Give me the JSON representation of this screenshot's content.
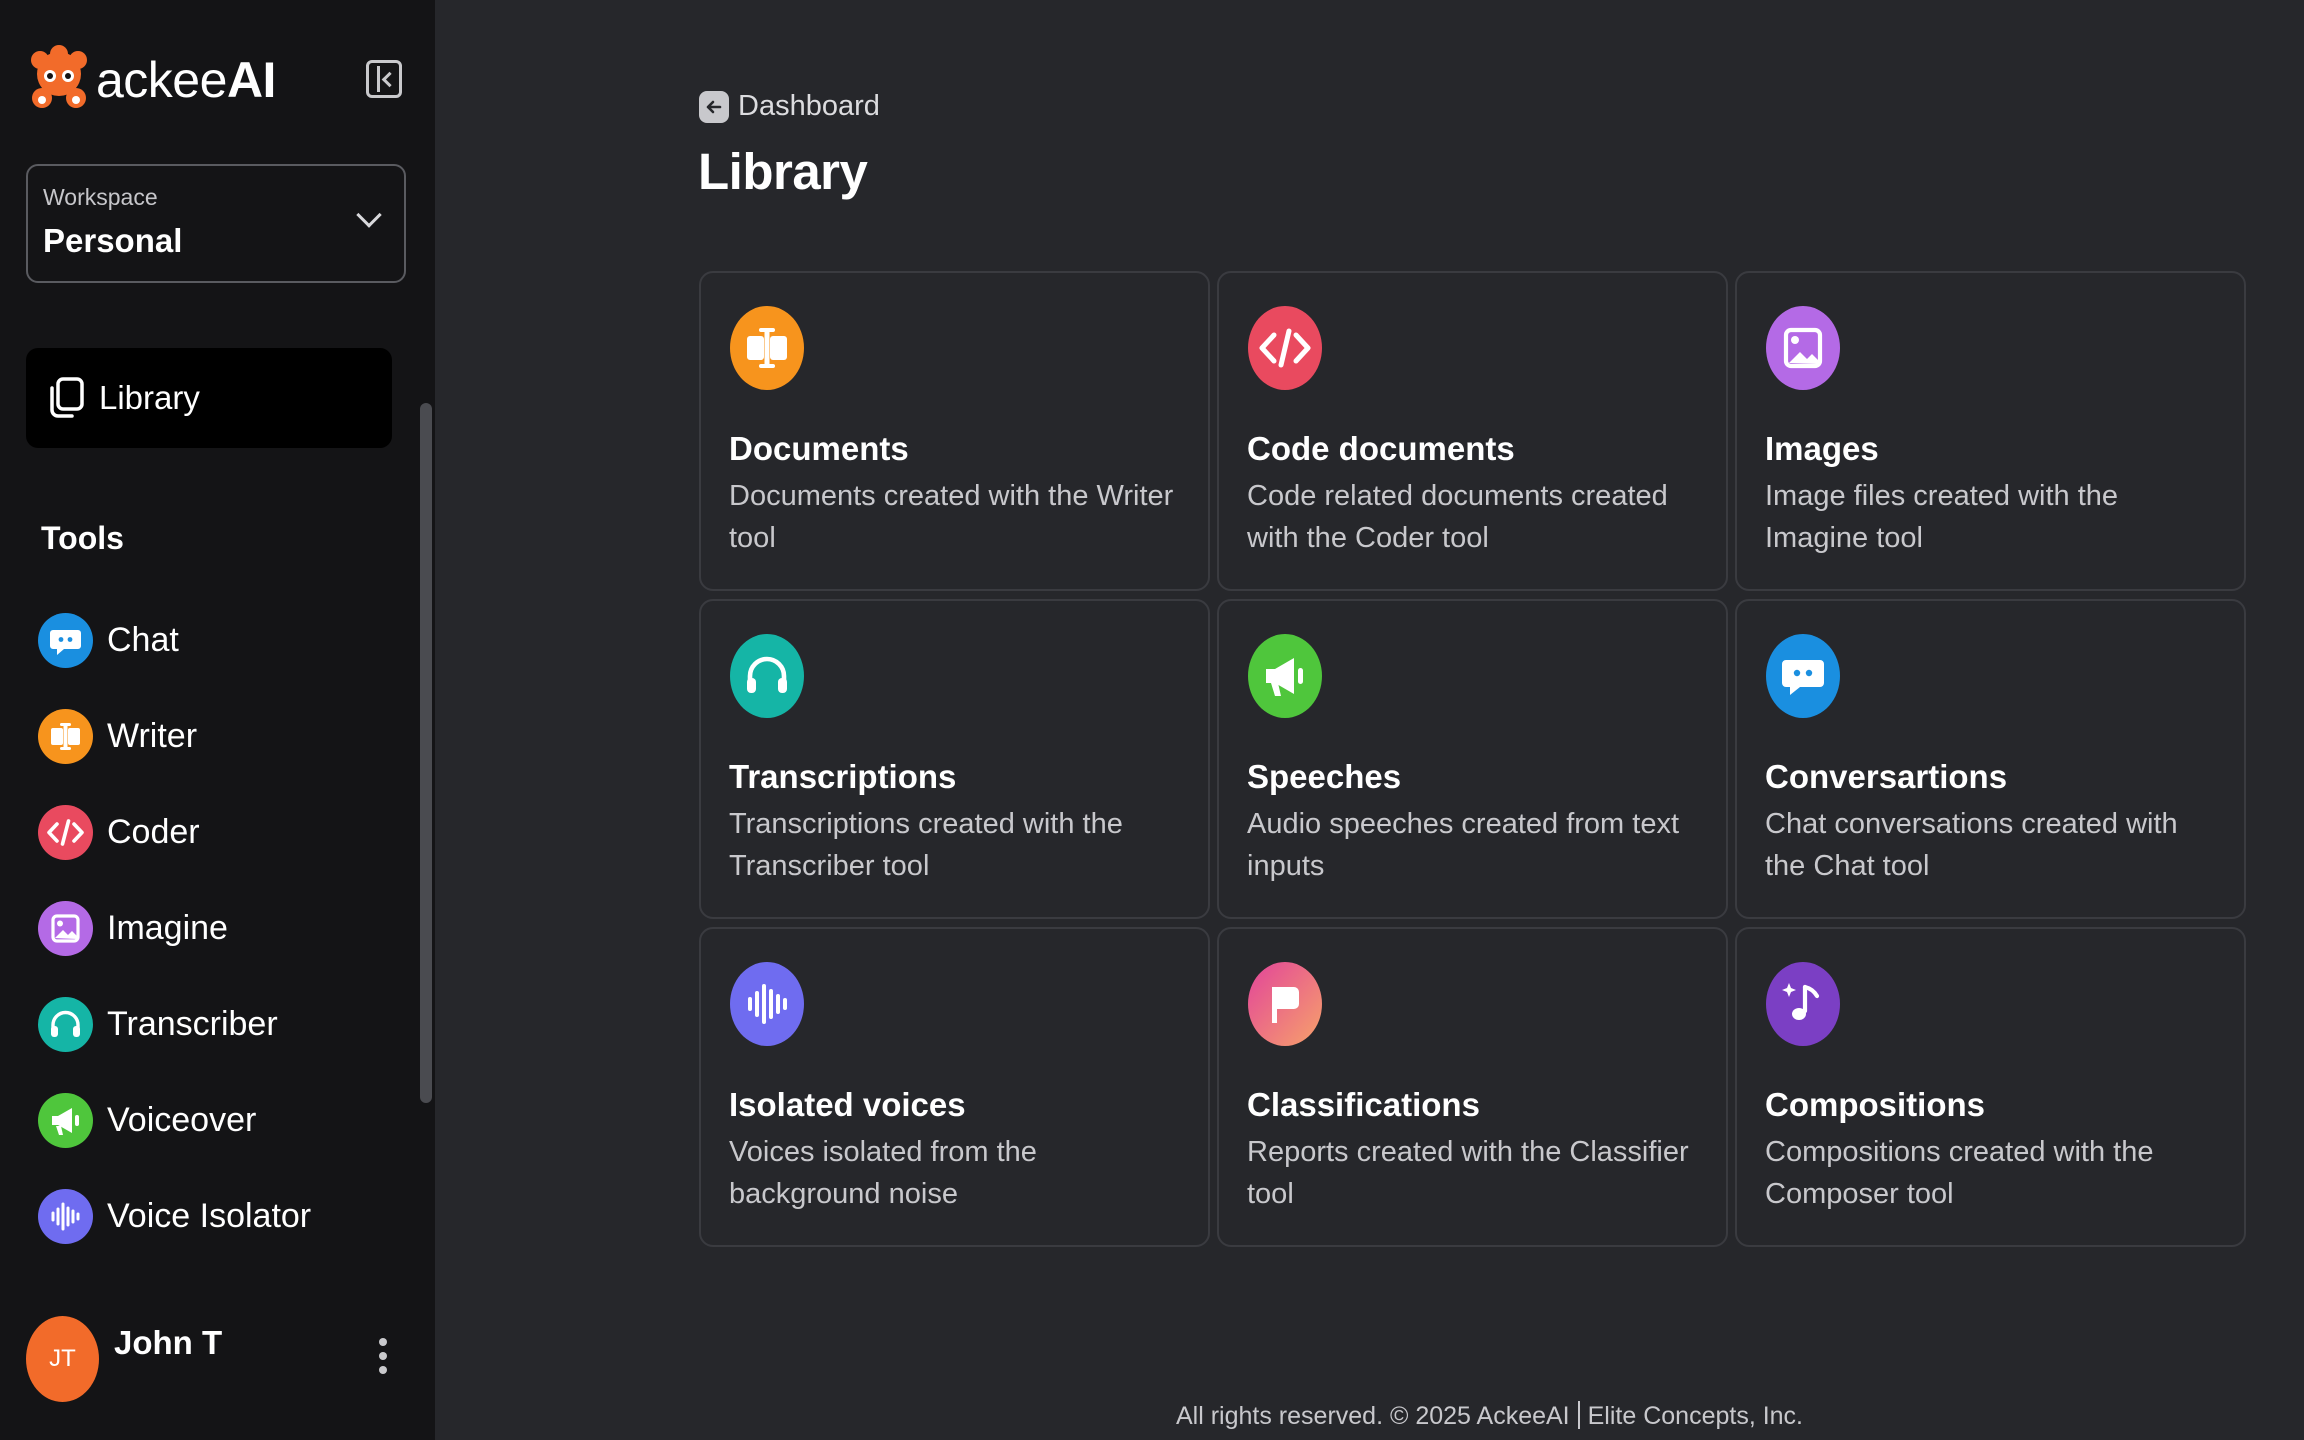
{
  "brand": {
    "prefix": "ackee",
    "suffix": "AI"
  },
  "workspace": {
    "label": "Workspace",
    "value": "Personal"
  },
  "nav": {
    "library_label": "Library"
  },
  "tools": {
    "heading": "Tools",
    "items": [
      {
        "label": "Chat",
        "icon": "chat-bubble-icon",
        "color": "#1a8fe0"
      },
      {
        "label": "Writer",
        "icon": "writer-icon",
        "color": "#f7941d"
      },
      {
        "label": "Coder",
        "icon": "code-icon",
        "color": "#e94a5f"
      },
      {
        "label": "Imagine",
        "icon": "image-icon",
        "color": "#b46ae6"
      },
      {
        "label": "Transcriber",
        "icon": "headphones-icon",
        "color": "#15b5a6"
      },
      {
        "label": "Voiceover",
        "icon": "megaphone-icon",
        "color": "#4fc63c"
      },
      {
        "label": "Voice Isolator",
        "icon": "soundwave-icon",
        "color": "#6f6cf0"
      }
    ]
  },
  "user": {
    "initials": "JT",
    "name": "John T"
  },
  "main": {
    "back_label": "Dashboard",
    "title": "Library",
    "cards": [
      {
        "title": "Documents",
        "description": "Documents created with the Writer tool",
        "icon": "writer-icon",
        "color": "#f7941d"
      },
      {
        "title": "Code documents",
        "description": "Code related documents created with the Coder tool",
        "icon": "code-icon",
        "color": "#e94a5f"
      },
      {
        "title": "Images",
        "description": "Image files created with the Imagine tool",
        "icon": "image-icon",
        "color": "#b46ae6"
      },
      {
        "title": "Transcriptions",
        "description": "Transcriptions created with the Transcriber tool",
        "icon": "headphones-icon",
        "color": "#15b5a6"
      },
      {
        "title": "Speeches",
        "description": "Audio speeches created from text inputs",
        "icon": "megaphone-icon",
        "color": "#4fc63c"
      },
      {
        "title": "Conversartions",
        "description": "Chat conversations created with the Chat tool",
        "icon": "chat-bubble-icon",
        "color": "#1a8fe0"
      },
      {
        "title": "Isolated voices",
        "description": "Voices isolated from the background noise",
        "icon": "soundwave-icon",
        "color": "#6f6cf0"
      },
      {
        "title": "Classifications",
        "description": "Reports created with the Classifier tool",
        "icon": "flag-icon",
        "color": "#e8568f"
      },
      {
        "title": "Compositions",
        "description": "Compositions created with the Composer tool",
        "icon": "music-note-icon",
        "color": "#7b3fc4"
      }
    ]
  },
  "footer": {
    "left": "All rights reserved. © 2025 AckeeAI",
    "right": "Elite Concepts, Inc."
  }
}
